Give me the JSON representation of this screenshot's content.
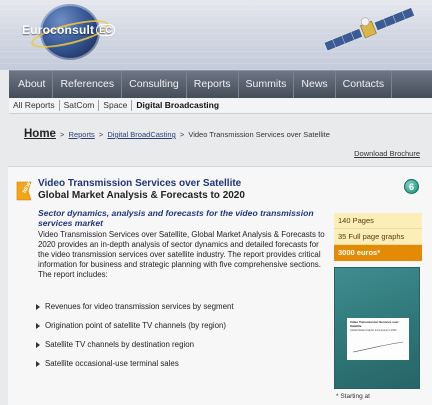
{
  "brand": {
    "logo_text": "Euroconsult",
    "logo_mark": "EC"
  },
  "nav": {
    "items": [
      "About",
      "References",
      "Consulting",
      "Reports",
      "Summits",
      "News",
      "Contacts"
    ]
  },
  "subnav": {
    "items": [
      "All Reports",
      "SatCom",
      "Space",
      "Digital Broadcasting"
    ],
    "active": "Digital Broadcasting"
  },
  "breadcrumb": {
    "home": "Home",
    "reports": "Reports",
    "category": "Digital BroadCasting",
    "current": "Video Transmission Services over Satellite",
    "separator": ">"
  },
  "download_label": "Download Brochure",
  "product": {
    "badge": "NEW",
    "title": "Video Transmission Services over Satellite",
    "subtitle": "Global Market Analysis & Forecasts to 2020",
    "info_icon": "6",
    "tagline": "Sector dynamics, analysis and forecasts for the video transmission services market",
    "description": "Video Transmission Services over Satellite, Global Market Analysis & Forecasts to 2020 provides an in-depth analysis of sector dynamics and detailed forecasts for the video transmission services over satellite industry. The report provides critical information for business and strategic planning with five comprehensive sections. The report includes:",
    "bullets": [
      "Revenues for video transmission services by segment",
      "Origination point of satellite TV channels (by region)",
      "Satellite TV channels by destination region",
      "Satellite occasional-use terminal sales"
    ]
  },
  "specs": {
    "pages": "140 Pages",
    "graphs": "35 Full page graphs",
    "price": "3000 euros*"
  },
  "cover": {
    "title": "Video Transmission Services over Satellite",
    "subtitle": "Global Market Analysis & Forecasts to 2020"
  },
  "footnote": "* Starting at",
  "colors": {
    "title_blue": "#1f3577",
    "price_orange": "#e38b07",
    "spec_bg": "#fbeeb8",
    "nav_dark": "#454d59",
    "cover_teal": "#2f7678"
  },
  "icons": [
    "globe-logo-icon",
    "satellite-icon",
    "new-badge-icon",
    "info-icon",
    "bullet-arrow-icon"
  ]
}
